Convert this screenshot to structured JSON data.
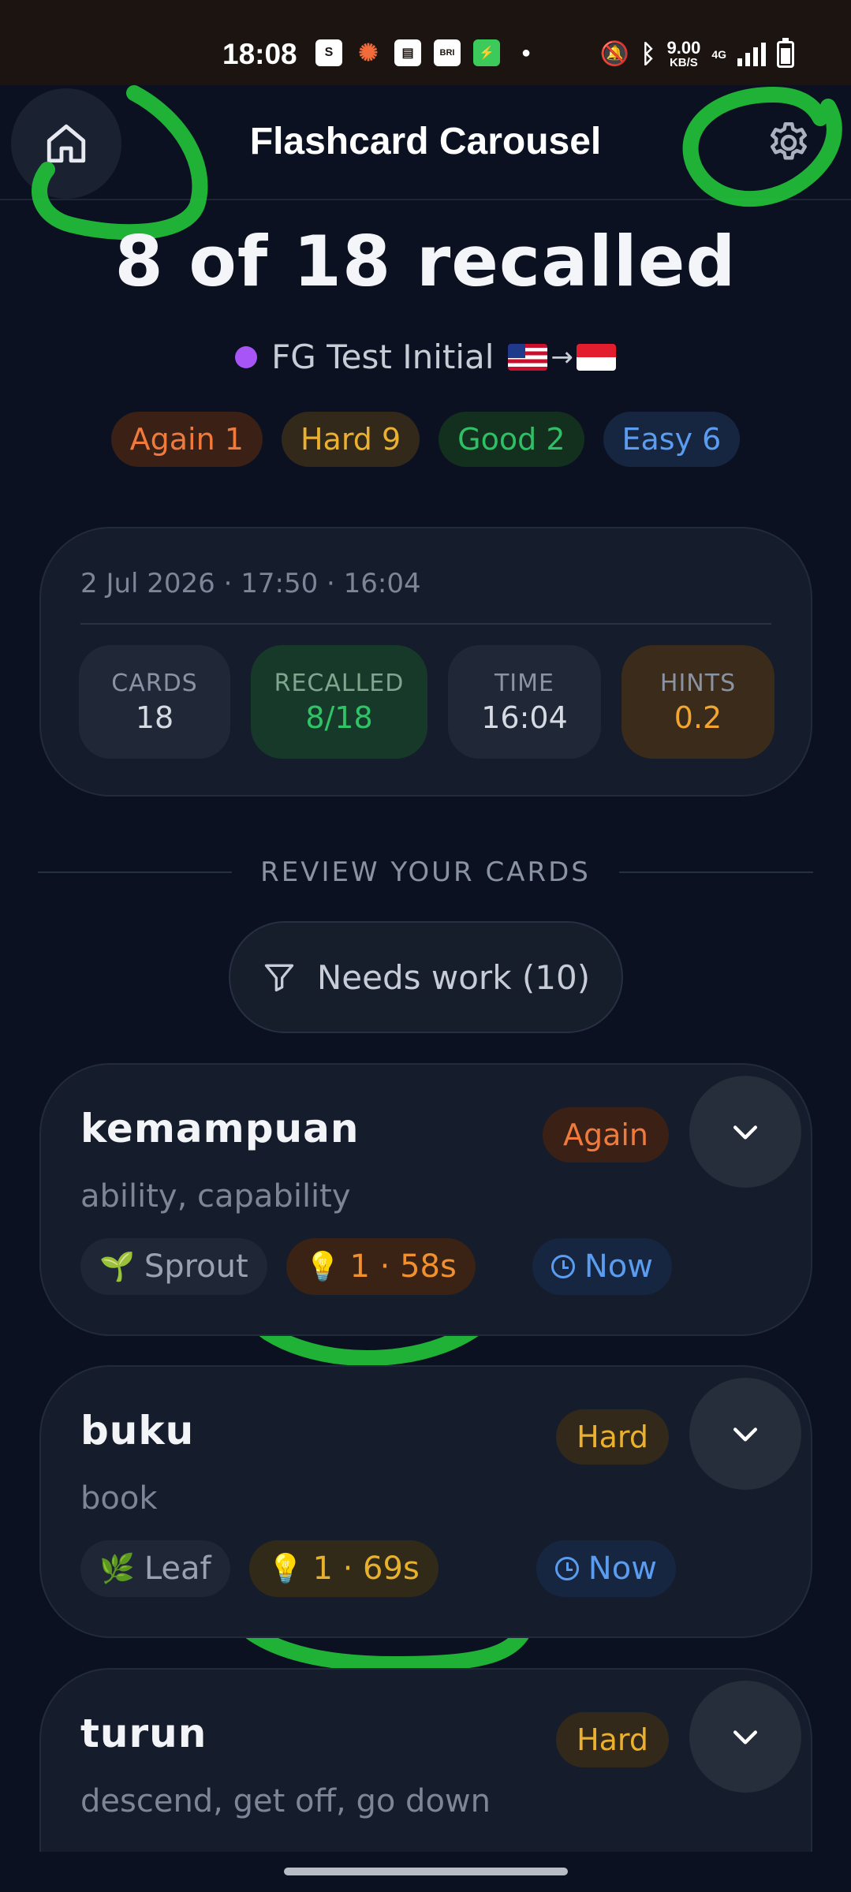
{
  "status_bar": {
    "time": "18:08",
    "speed_value": "9.00",
    "speed_unit": "KB/S",
    "network": "4G"
  },
  "app": {
    "title": "Flashcard Carousel",
    "home_icon": "home-icon",
    "settings_icon": "gear-icon"
  },
  "result": {
    "headline": "8 of 18 recalled",
    "deck_name": "FG Test Initial",
    "deck_color": "#a855f7",
    "direction_arrow": "→"
  },
  "ratings": [
    {
      "label": "Again 1",
      "color": "#f07a3c"
    },
    {
      "label": "Hard 9",
      "color": "#eab02e"
    },
    {
      "label": "Good 2",
      "color": "#2fbf64"
    },
    {
      "label": "Easy 6",
      "color": "#5a9cf0"
    }
  ],
  "summary": {
    "date_line": "2 Jul 2026 · 17:50 · 16:04",
    "stats": [
      {
        "label": "CARDS",
        "value": "18"
      },
      {
        "label": "RECALLED",
        "value": "8/18"
      },
      {
        "label": "TIME",
        "value": "16:04"
      },
      {
        "label": "HINTS",
        "value": "0.2"
      }
    ]
  },
  "review": {
    "section_label": "REVIEW YOUR CARDS",
    "filter_label": "Needs work (10)"
  },
  "cards": [
    {
      "word": "kemampuan",
      "meaning": "ability, capability",
      "rating": "Again",
      "stage_emoji": "🌱",
      "stage": "Sprout",
      "hint_emoji": "💡",
      "hint": "1 · 58s",
      "due": "Now"
    },
    {
      "word": "buku",
      "meaning": "book",
      "rating": "Hard",
      "stage_emoji": "🌿",
      "stage": "Leaf",
      "hint_emoji": "💡",
      "hint": "1 · 69s",
      "due": "Now"
    },
    {
      "word": "turun",
      "meaning": "descend, get off, go down",
      "rating": "Hard"
    }
  ]
}
